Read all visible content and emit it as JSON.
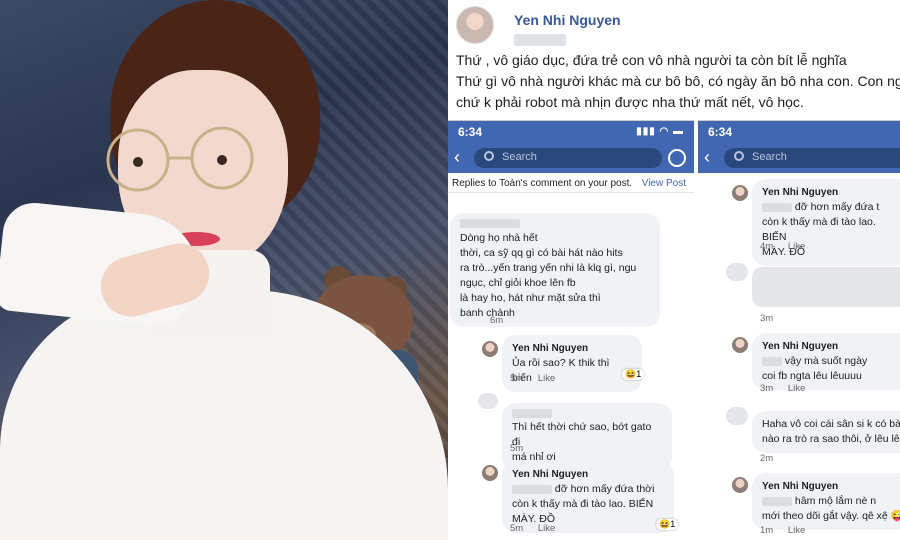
{
  "post": {
    "author": "Yen Nhi Nguyen",
    "lines": [
      "Thứ          , vô giáo dục, đứa trẻ con vô nhà người ta còn bít lễ nghĩa",
      "Thứ gì vô nhà người khác mà cư bô bô, có ngày ăn bô nha con. Con ng",
      "chứ k phải robot mà nhịn được nha thứ mất nết, vô học."
    ]
  },
  "phone_left": {
    "time": "6:34",
    "search_placeholder": "Search",
    "replies_text": "Replies to Toàn's comment on your post.",
    "view_post": "View Post",
    "comments": [
      {
        "lines": [
          "Dòng họ nhà                    hết",
          "thời, ca sỹ qq gì      có bài hát nào hits",
          "ra trò...yến trang yến nhi là klq gì, ngu",
          "ngục, chỉ giỏi khoe              lên fb",
          "là hay ho, hát như      mặt sửa thì",
          "banh chành"
        ],
        "time": "6m"
      },
      {
        "name": "Yen Nhi Nguyen",
        "lines": [
          "Ủa rồi sao? K thik thì biến"
        ],
        "time": "5m",
        "like": "Like",
        "reaction": "😆1"
      },
      {
        "lines": [
          "Thì hết thời chứ sao, bớt gato đi",
          "má nhỉ ơi"
        ],
        "time": "5m"
      },
      {
        "name": "Yen Nhi Nguyen",
        "lines": [
          "đỡ hơn mấy đứa thời",
          "còn k thấy mà đi tào lao. BIẾN",
          "MÀY. ĐỒ"
        ],
        "time": "5m",
        "like": "Like",
        "reaction": "😆1"
      }
    ]
  },
  "phone_right": {
    "time": "6:34",
    "search_placeholder": "Search",
    "comments": [
      {
        "name": "Yen Nhi Nguyen",
        "lines": [
          "đỡ hơn mấy đứa t",
          "còn k thấy mà đi tào lao. BIẾN",
          "MÀY. ĐỒ"
        ],
        "time": "4m",
        "like": "Like"
      },
      {
        "time": "3m"
      },
      {
        "name": "Yen Nhi Nguyen",
        "lines": [
          "vậy mà suốt ngày",
          "coi fb ngta lêu lêuuuu"
        ],
        "time": "3m",
        "like": "Like"
      },
      {
        "lines": [
          "Haha vô coi cái sân si k có bà",
          "nào ra trò ra sao thôi, ở lêu lê"
        ],
        "time": "2m"
      },
      {
        "name": "Yen Nhi Nguyen",
        "lines": [
          "hâm mộ lắm nè n",
          "mới theo dõi gắt vậy. qê xệ 😜"
        ],
        "time": "1m",
        "like": "Like"
      }
    ]
  },
  "colors": {
    "fb_blue": "#4267b2",
    "link": "#385898",
    "bubble": "#f0f2f5"
  }
}
